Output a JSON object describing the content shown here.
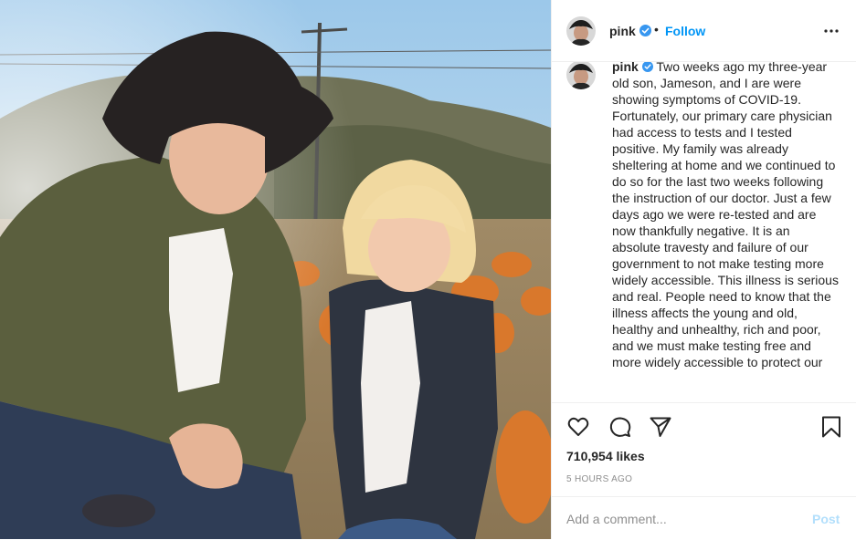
{
  "post": {
    "username": "pink",
    "verified": true,
    "separator": "•",
    "follow_label": "Follow",
    "photo_alt": "Woman in a wide-brim hat and a young blond child in a plaid shirt at a pumpkin patch",
    "caption_user": "pink",
    "caption_text": "Two weeks ago my three-year old son, Jameson, and I are were showing symptoms of COVID-19. Fortunately, our primary care physician had access to tests and I tested positive. My family was already sheltering at home and we continued to do so for the last two weeks following the instruction of our doctor. Just a few days ago we were re-tested and are now thankfully negative. It is an absolute travesty and failure of our government to not make testing more widely accessible. This illness is serious and real. People need to know that the illness affects the young and old, healthy and unhealthy, rich and poor, and we must make testing free and more widely accessible to protect our",
    "likes": "710,954 likes",
    "time": "5 HOURS AGO"
  },
  "comment": {
    "placeholder": "Add a comment...",
    "post_label": "Post"
  },
  "colors": {
    "link_blue": "#0095f6",
    "post_disabled": "#b2dffc",
    "text": "#262626",
    "muted": "#8e8e8e",
    "divider": "#efefef"
  },
  "icons": {
    "header": [
      "verified-badge-icon",
      "more-options-icon"
    ],
    "actions": [
      "heart-icon",
      "comment-icon",
      "share-icon",
      "bookmark-icon"
    ]
  }
}
